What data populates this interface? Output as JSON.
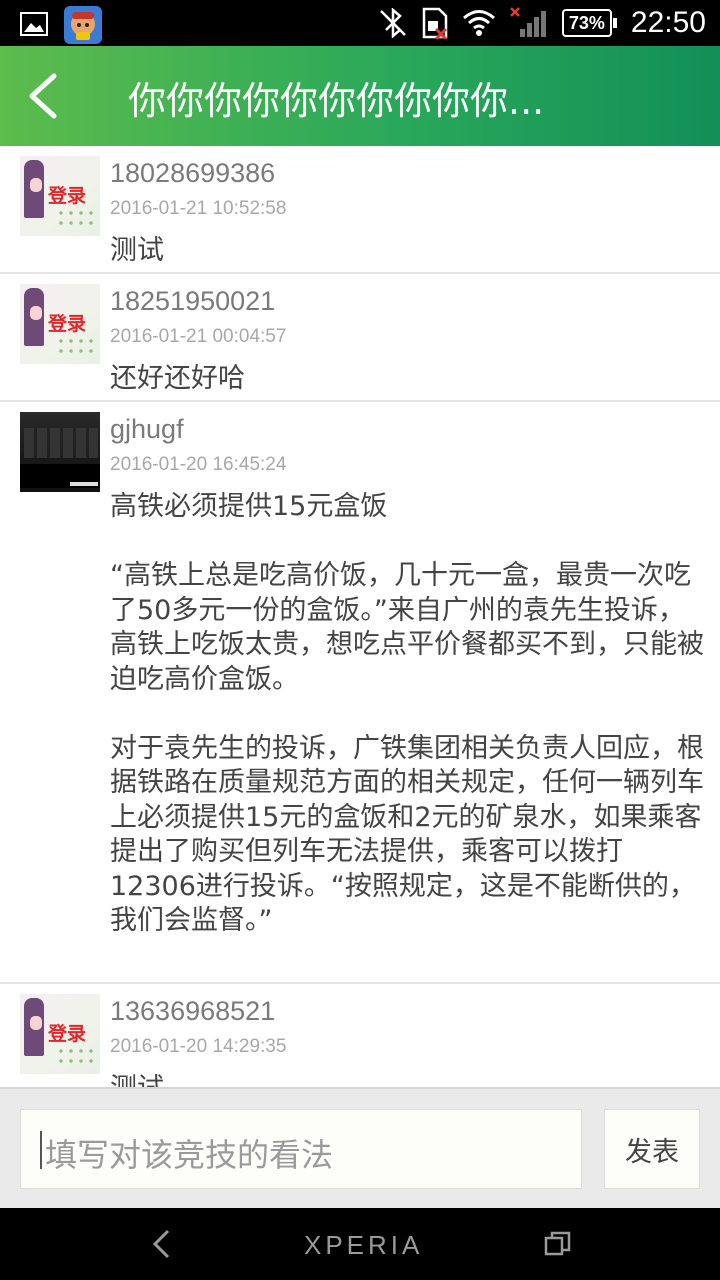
{
  "status_bar": {
    "time": "22:50",
    "battery": "73%"
  },
  "header": {
    "title": "你你你你你你你你你你..."
  },
  "comments": [
    {
      "user": "18028699386",
      "date": "2016-01-21 10:52:58",
      "avatar_label": "登录",
      "content": [
        "测试"
      ]
    },
    {
      "user": "18251950021",
      "date": "2016-01-21 00:04:57",
      "avatar_label": "登录",
      "content": [
        "还好还好哈"
      ]
    },
    {
      "user": "gjhugf",
      "date": "2016-01-20 16:45:24",
      "content": [
        "高铁必须提供15元盒饭",
        "“高铁上总是吃高价饭，几十元一盒，最贵一次吃了50多元一份的盒饭。”来自广州的袁先生投诉，高铁上吃饭太贵，想吃点平价餐都买不到，只能被迫吃高价盒饭。",
        "对于袁先生的投诉，广铁集团相关负责人回应，根据铁路在质量规范方面的相关规定，任何一辆列车上必须提供15元的盒饭和2元的矿泉水，如果乘客提出了购买但列车无法提供，乘客可以拨打12306进行投诉。“按照规定，这是不能断供的，我们会监督。”"
      ]
    },
    {
      "user": "13636968521",
      "date": "2016-01-20 14:29:35",
      "avatar_label": "登录",
      "content": [
        "测试"
      ]
    }
  ],
  "input": {
    "placeholder": "填写对该竞技的看法",
    "send_label": "发表"
  },
  "nav": {
    "brand": "XPERIA"
  },
  "colors": {
    "header_start": "#5cbc4c",
    "header_end": "#119057"
  }
}
